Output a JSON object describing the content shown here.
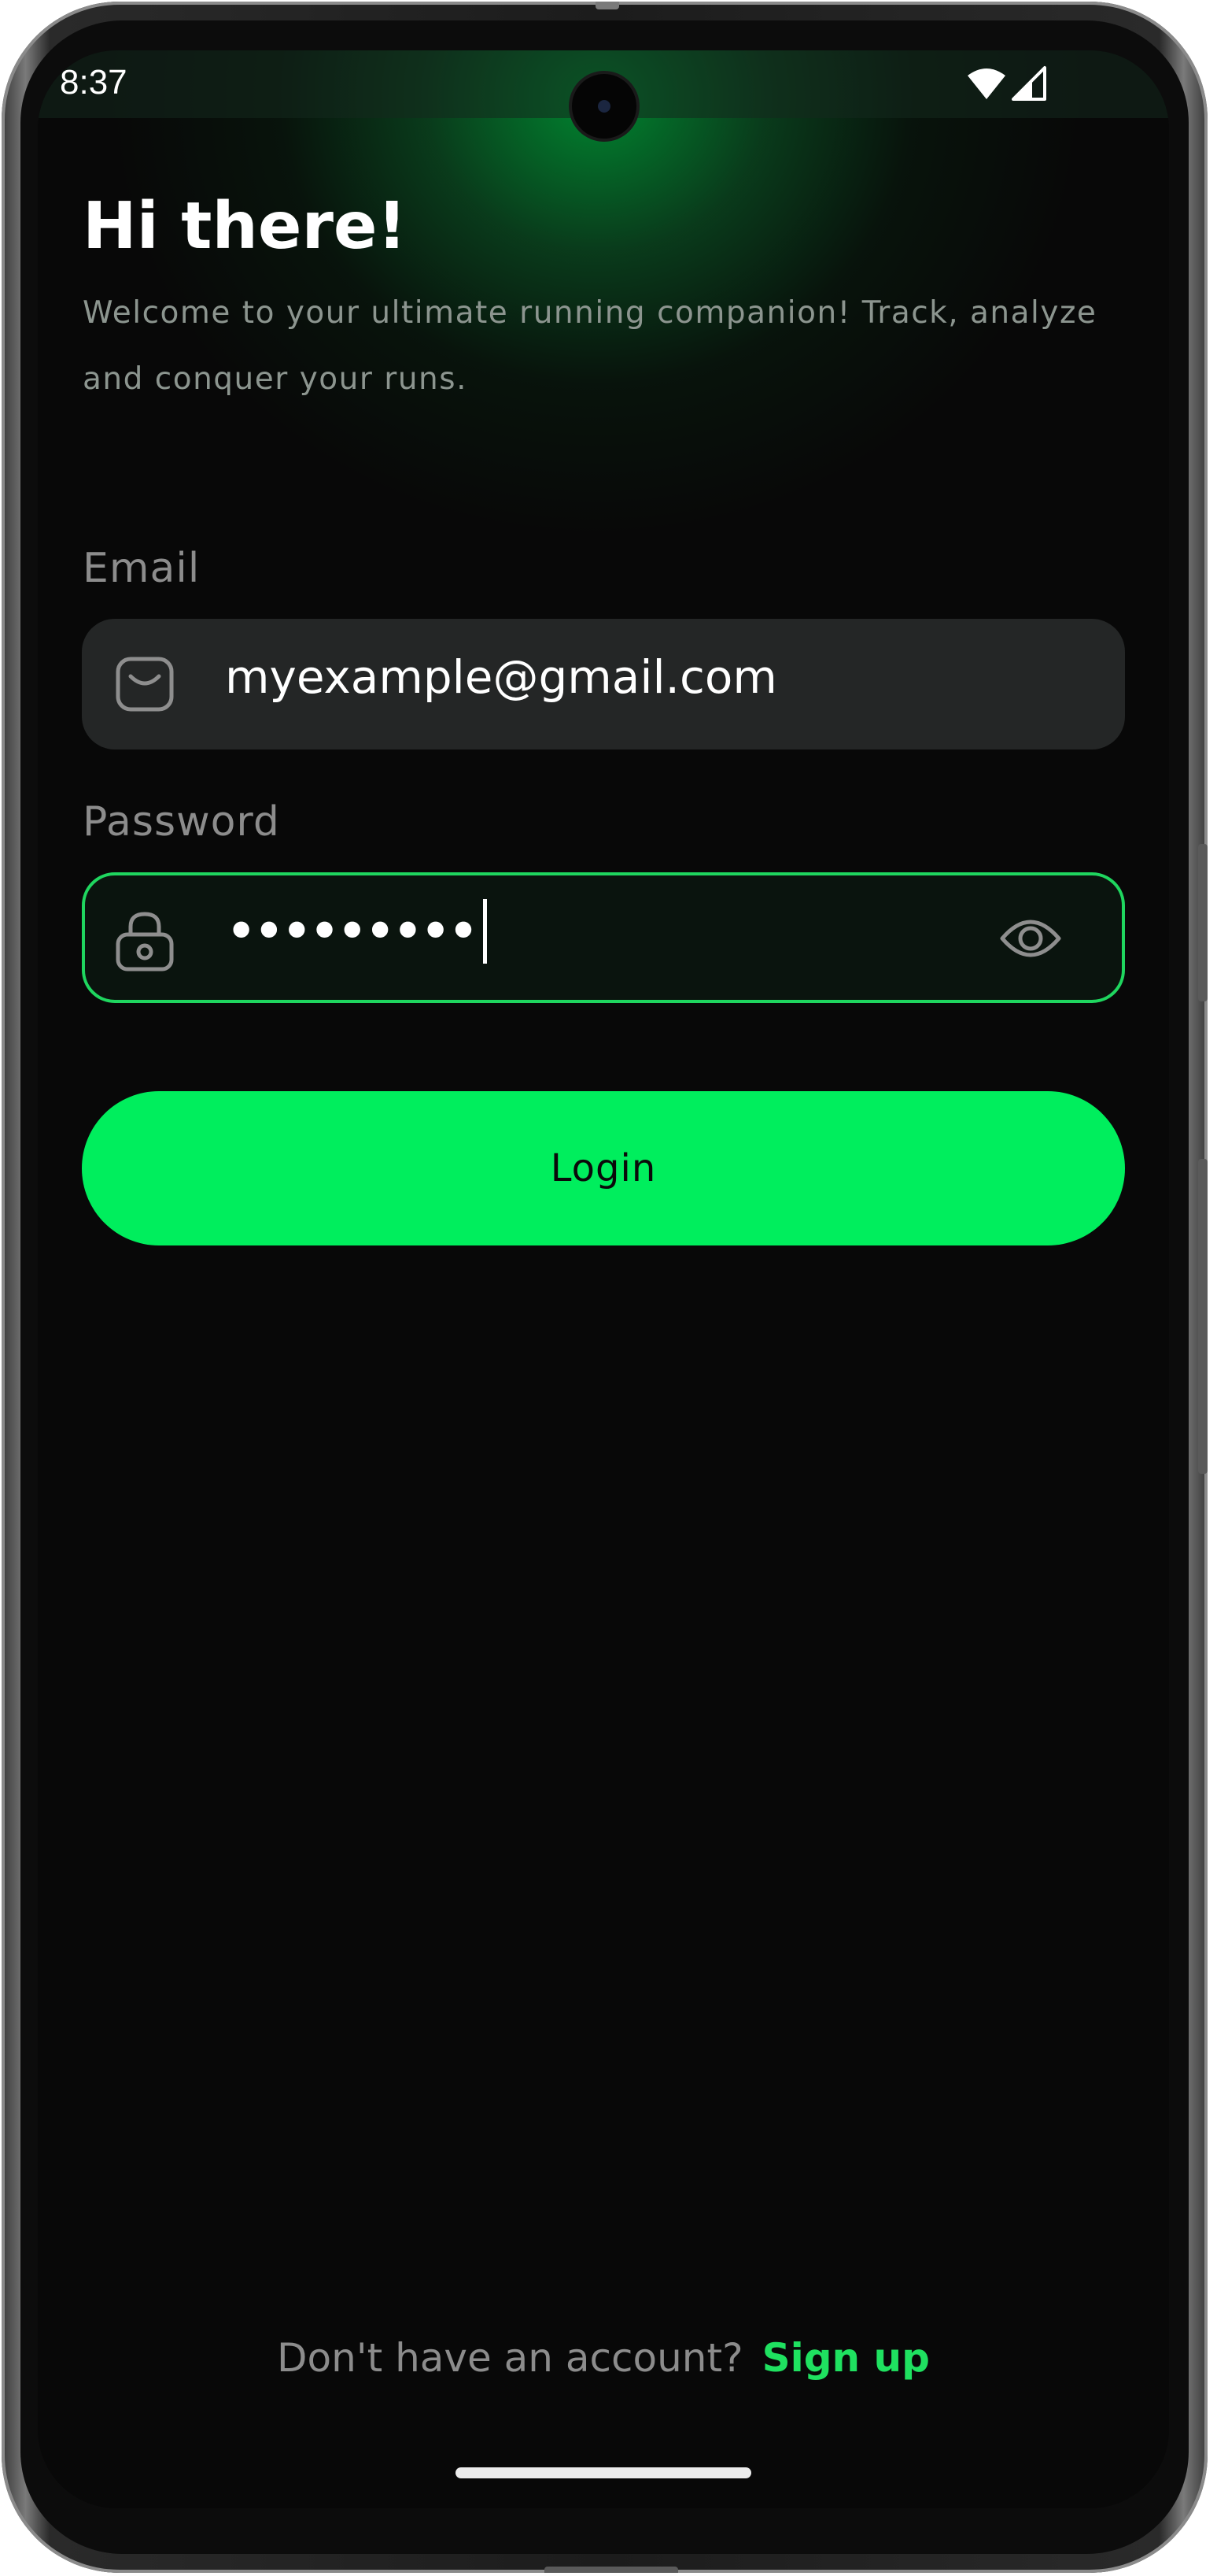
{
  "status_bar": {
    "time": "8:37",
    "icons": [
      "wifi-icon",
      "cellular-signal-icon"
    ]
  },
  "header": {
    "title": "Hi there!",
    "subtitle": "Welcome to your ultimate running companion! Track, analyze and conquer your runs."
  },
  "form": {
    "email": {
      "label": "Email",
      "value": "myexample@gmail.com",
      "icon": "mail-icon"
    },
    "password": {
      "label": "Password",
      "value": "•••••••••",
      "icon": "lock-icon",
      "toggle_icon": "eye-icon"
    },
    "login_label": "Login"
  },
  "footer": {
    "prompt": "Don't have an account?",
    "link": "Sign up"
  },
  "colors": {
    "accent": "#00ee5d",
    "focus_border": "#1fd65f",
    "link": "#1fe160",
    "background": "#080808",
    "field_background": "#242626"
  }
}
